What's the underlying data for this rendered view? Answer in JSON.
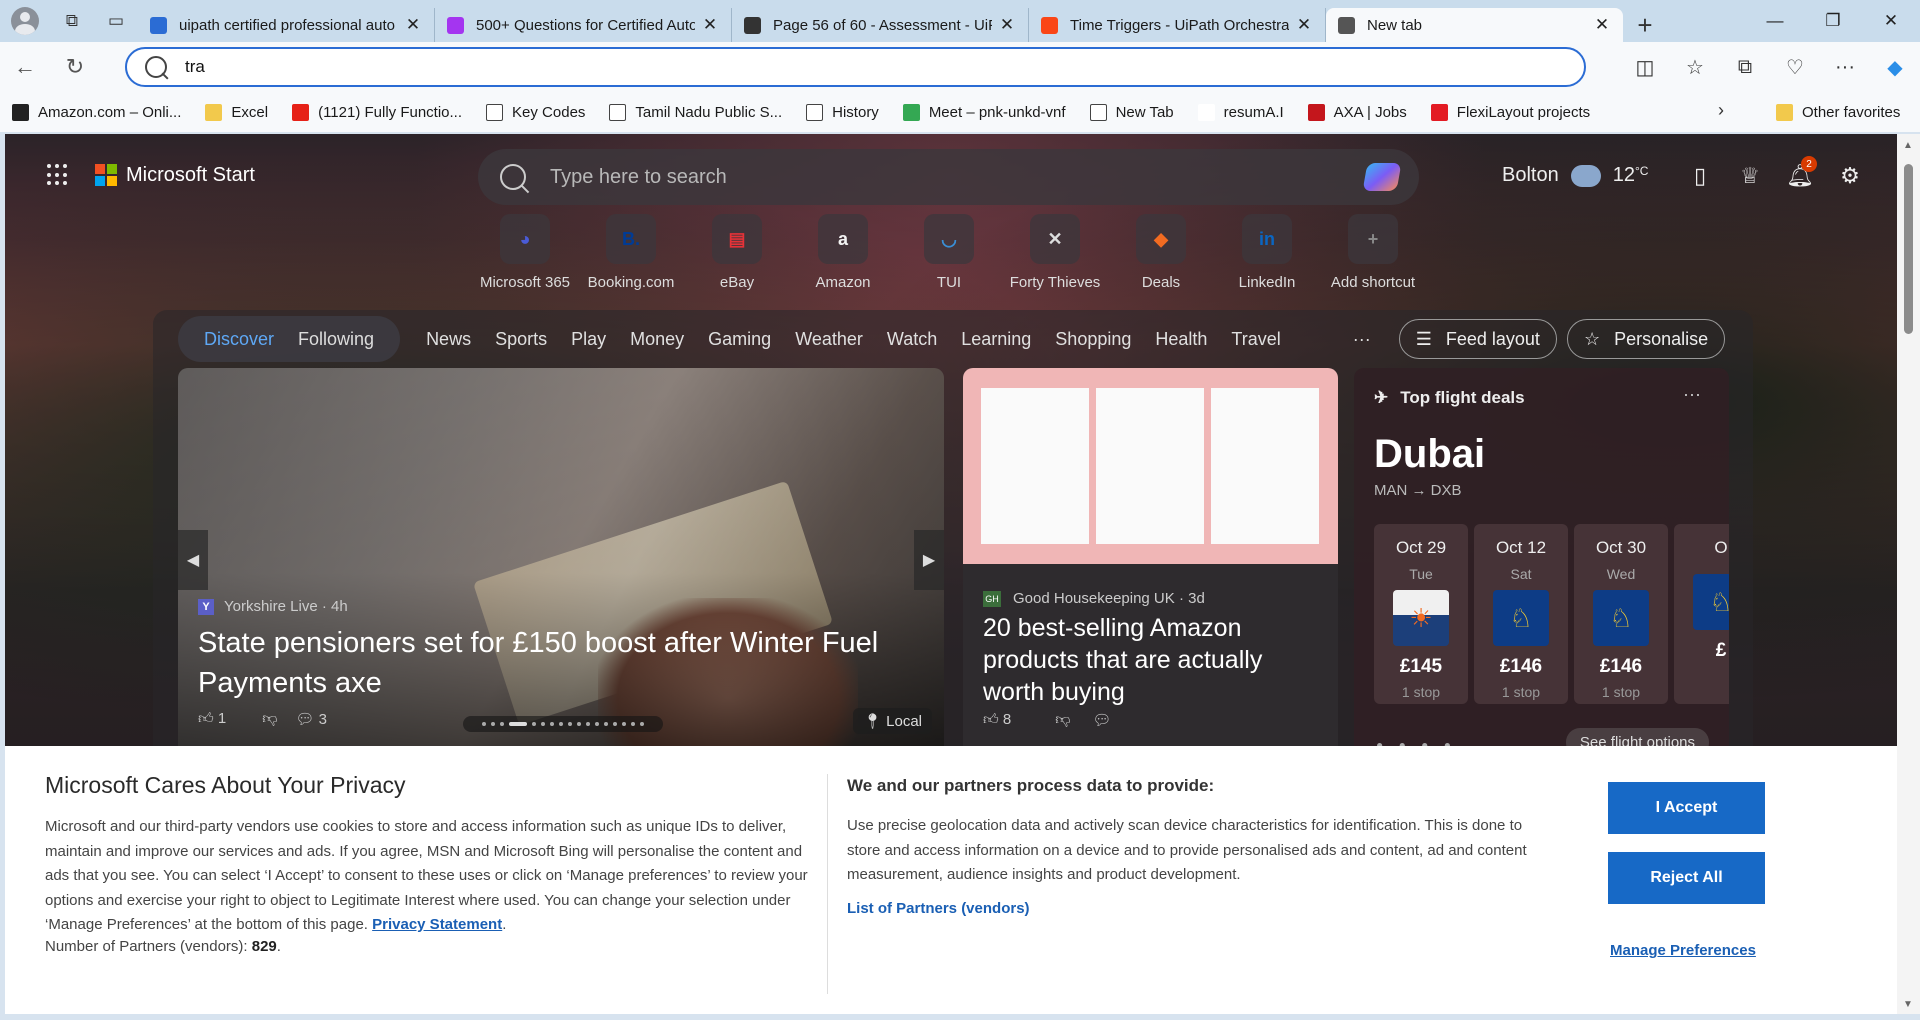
{
  "browser": {
    "tabs": [
      {
        "title": "uipath certified professional auto",
        "favicon": "search-favicon",
        "color": "#2b6cd4"
      },
      {
        "title": "500+ Questions for Certified Auto",
        "favicon": "udemy-favicon",
        "color": "#a435f0"
      },
      {
        "title": "Page 56 of 60 - Assessment - UiP",
        "favicon": "bing-favicon",
        "color": "#333333"
      },
      {
        "title": "Time Triggers - UiPath Orchestrat",
        "favicon": "uipath-favicon",
        "color": "#fa4616"
      },
      {
        "title": "New tab",
        "favicon": "new-tab-favicon",
        "color": "#555555"
      }
    ],
    "address": {
      "value": "tra"
    },
    "favorites": [
      {
        "label": "Amazon.com – Onli...",
        "icon": "amazon-icon"
      },
      {
        "label": "Excel",
        "icon": "folder-icon"
      },
      {
        "label": "(1121) Fully Functio...",
        "icon": "youtube-icon"
      },
      {
        "label": "Key Codes",
        "icon": "page-icon"
      },
      {
        "label": "Tamil Nadu Public S...",
        "icon": "page-icon"
      },
      {
        "label": "History",
        "icon": "page-icon"
      },
      {
        "label": "Meet – pnk-unkd-vnf",
        "icon": "meet-icon"
      },
      {
        "label": "New Tab",
        "icon": "page-icon"
      },
      {
        "label": "resumA.I",
        "icon": "ai-icon"
      },
      {
        "label": "AXA | Jobs",
        "icon": "axa-icon"
      },
      {
        "label": "FlexiLayout projects",
        "icon": "abbyy-icon"
      }
    ],
    "other_favorites": "Other favorites"
  },
  "msn": {
    "brand": "Microsoft Start",
    "search_placeholder": "Type here to search",
    "location": "Bolton",
    "temperature": "12",
    "temp_unit": "°C",
    "notification_count": "2",
    "shortcuts": [
      {
        "label": "Microsoft 365",
        "glyph": "◕",
        "color": "#4a5bd6"
      },
      {
        "label": "Booking.com",
        "glyph": "B.",
        "color": "#003b95"
      },
      {
        "label": "eBay",
        "glyph": "▤",
        "color": "#e53238"
      },
      {
        "label": "Amazon",
        "glyph": "a",
        "color": "#f3f3f3"
      },
      {
        "label": "TUI",
        "glyph": "◡",
        "color": "#3a8fd6"
      },
      {
        "label": "Forty Thieves",
        "glyph": "✕",
        "color": "#dddddd"
      },
      {
        "label": "Deals",
        "glyph": "◆",
        "color": "#f26b21"
      },
      {
        "label": "LinkedIn",
        "glyph": "in",
        "color": "#0a66c2"
      },
      {
        "label": "Add shortcut",
        "glyph": "+",
        "color": "#888888"
      }
    ],
    "feed_tabs": {
      "discover": "Discover",
      "following": "Following"
    },
    "nav": [
      "News",
      "Sports",
      "Play",
      "Money",
      "Gaming",
      "Weather",
      "Watch",
      "Learning",
      "Shopping",
      "Health",
      "Travel"
    ],
    "more": "···",
    "feed_layout": "Feed layout",
    "personalise": "Personalise",
    "hero": {
      "source": "Yorkshire Live",
      "age": "· 4h",
      "title": "State pensioners set for £150 boost after Winter Fuel Payments axe",
      "likes": "1",
      "comments": "3",
      "local": "Local"
    },
    "amazon_card": {
      "source": "Good Housekeeping UK",
      "age": "· 3d",
      "title": "20 best-selling Amazon products that are actually worth buying",
      "likes": "8"
    },
    "flights": {
      "heading": "Top flight deals",
      "city": "Dubai",
      "route": "MAN → DXB",
      "deals": [
        {
          "date": "Oct 29",
          "day": "Tue",
          "price": "£145",
          "stops": "1 stop",
          "airline": "easyjet-logo"
        },
        {
          "date": "Oct 12",
          "day": "Sat",
          "price": "£146",
          "stops": "1 stop",
          "airline": "ryanair-logo"
        },
        {
          "date": "Oct 30",
          "day": "Wed",
          "price": "£146",
          "stops": "1 stop",
          "airline": "ryanair-logo"
        },
        {
          "date": "O",
          "day": "",
          "price": "£",
          "stops": "",
          "airline": "ryanair-logo"
        }
      ],
      "see_options": "See flight options"
    }
  },
  "privacy": {
    "title": "Microsoft Cares About Your Privacy",
    "body": "Microsoft and our third-party vendors use cookies to store and access information such as unique IDs to deliver, maintain and improve our services and ads. If you agree, MSN and Microsoft Bing will personalise the content and ads that you see. You can select ‘I Accept’ to consent to these uses or click on ‘Manage preferences’ to review your options and exercise your right to object to Legitimate Interest where used. You can change your selection under ‘Manage Preferences’ at the bottom of this page.",
    "privacy_link": "Privacy Statement",
    "partners_label": "Number of Partners (vendors):",
    "partners_count": "829",
    "mid_heading": "We and our partners process data to provide:",
    "mid_body": "Use precise geolocation data and actively scan device characteristics for identification. This is done to store and access information on a device and to provide personalised ads and content, ad and content measurement, audience insights and product development.",
    "partners_link": "List of Partners (vendors)",
    "accept": "I Accept",
    "reject": "Reject All",
    "manage": "Manage Preferences"
  }
}
